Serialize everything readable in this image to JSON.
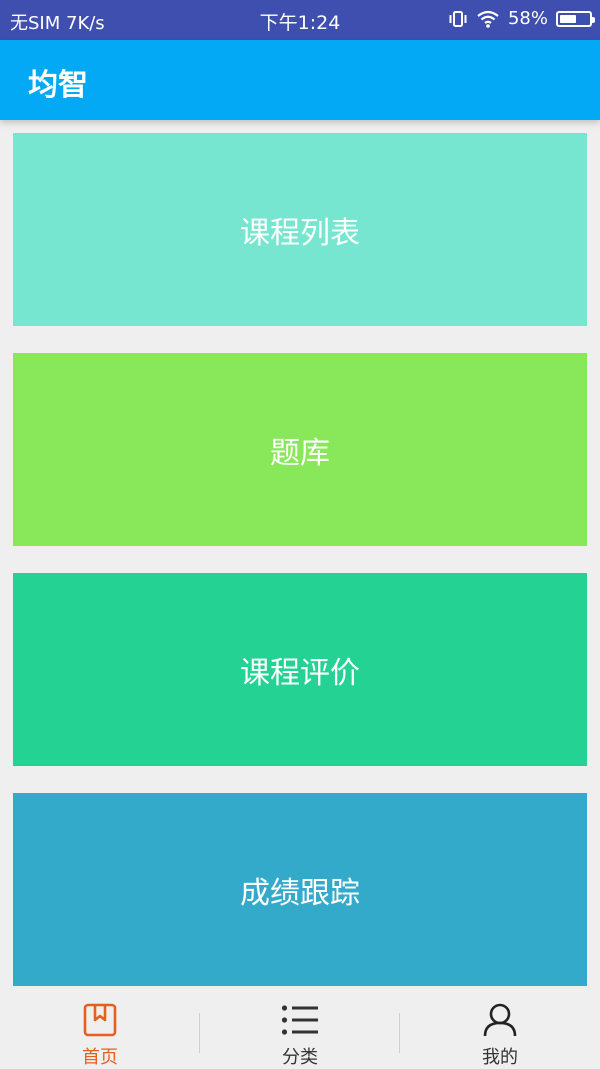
{
  "status_bar": {
    "carrier": "无SIM 7K/s",
    "time": "下午1:24",
    "battery_percent_text": "58%",
    "battery_level": 0.58,
    "icons": [
      "vibrate-icon",
      "wifi-icon",
      "battery-icon"
    ]
  },
  "app_bar": {
    "title": "均智",
    "background": "#03a9f4"
  },
  "cards": [
    {
      "label": "课程列表",
      "color": "#76e6d0"
    },
    {
      "label": "题库",
      "color": "#88e85a"
    },
    {
      "label": "课程评价",
      "color": "#24d294"
    },
    {
      "label": "成绩跟踪",
      "color": "#34aacb"
    }
  ],
  "bottom_nav": {
    "active_color": "#e65f1d",
    "tabs": [
      {
        "label": "首页",
        "icon": "bookmark-icon",
        "active": true
      },
      {
        "label": "分类",
        "icon": "list-icon",
        "active": false
      },
      {
        "label": "我的",
        "icon": "person-icon",
        "active": false
      }
    ]
  }
}
